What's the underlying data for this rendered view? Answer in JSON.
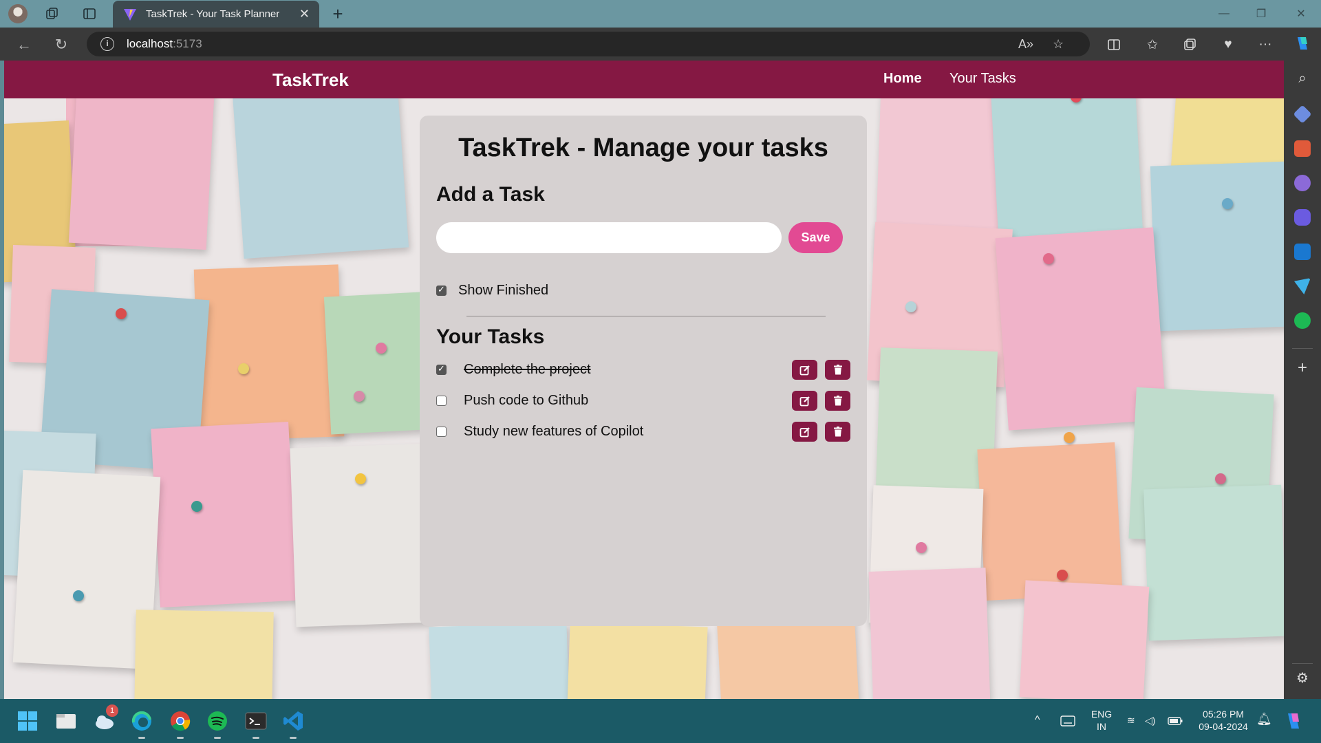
{
  "browser": {
    "tab_title": "TaskTrek - Your Task Planner",
    "address_host": "localhost",
    "address_port": ":5173"
  },
  "app": {
    "brand": "TaskTrek",
    "nav": [
      {
        "label": "Home",
        "active": true
      },
      {
        "label": "Your Tasks",
        "active": false
      }
    ],
    "heading": "TaskTrek - Manage your tasks",
    "add_heading": "Add a Task",
    "input": {
      "value": "",
      "placeholder": ""
    },
    "save_label": "Save",
    "show_finished": {
      "label": "Show Finished",
      "checked": true
    },
    "tasks_heading": "Your Tasks",
    "tasks": [
      {
        "text": "Complete the project",
        "done": true
      },
      {
        "text": "Push code to Github",
        "done": false
      },
      {
        "text": "Study new features of Copilot",
        "done": false
      }
    ],
    "colors": {
      "navbar": "#851843",
      "save_button": "#e24a93",
      "action_button": "#851843",
      "card": "#d6d1d1"
    }
  },
  "taskbar": {
    "weather_badge": "1",
    "language": "ENG",
    "region": "IN",
    "time": "05:26 PM",
    "date": "09-04-2024"
  }
}
